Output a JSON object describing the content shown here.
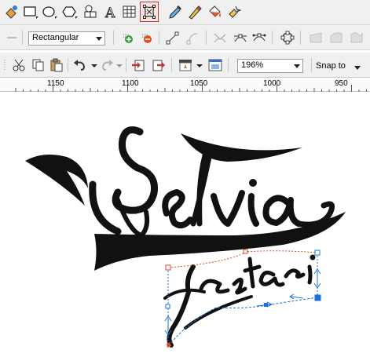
{
  "toolbox": {
    "tools": [
      {
        "name": "interactive-fill-tool-icon"
      },
      {
        "name": "rectangle-tool-icon"
      },
      {
        "name": "ellipse-tool-icon"
      },
      {
        "name": "polygon-tool-icon"
      },
      {
        "name": "basic-shapes-tool-icon"
      },
      {
        "name": "text-tool-icon"
      },
      {
        "name": "table-tool-icon"
      },
      {
        "name": "envelope-tool-icon",
        "active": true
      },
      {
        "name": "eyedropper-tool-icon"
      },
      {
        "name": "outline-pen-tool-icon"
      },
      {
        "name": "fill-bucket-tool-icon"
      },
      {
        "name": "smart-fill-tool-icon"
      }
    ],
    "text_tool_glyph": "A"
  },
  "property_bar": {
    "selection_mode": "Rectangular"
  },
  "standard_bar": {
    "zoom_level": "196%",
    "snap_label": "Snap to"
  },
  "ruler": {
    "labels": [
      "1150",
      "1100",
      "1050",
      "1000",
      "950"
    ]
  },
  "colors": {
    "toolbar_bg": "#f0f0f0",
    "artwork": "#111111",
    "envelope_line": "#1e6fd9",
    "selected_node": "#d84a2a"
  }
}
